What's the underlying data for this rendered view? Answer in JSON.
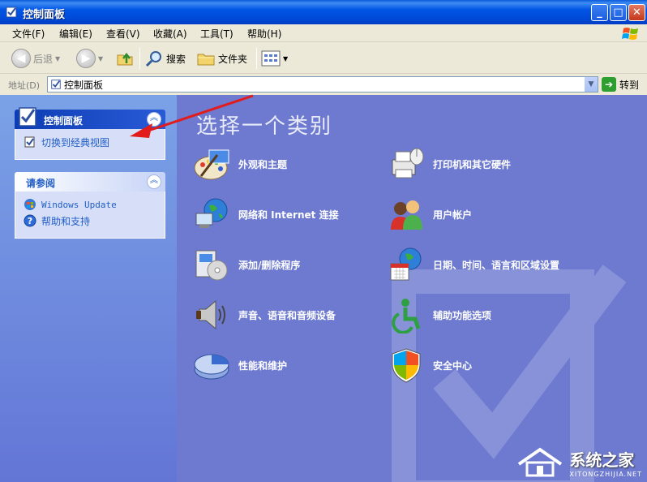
{
  "window": {
    "title": "控制面板"
  },
  "menu": [
    {
      "label": "文件(F)"
    },
    {
      "label": "编辑(E)"
    },
    {
      "label": "查看(V)"
    },
    {
      "label": "收藏(A)"
    },
    {
      "label": "工具(T)"
    },
    {
      "label": "帮助(H)"
    }
  ],
  "toolbar": {
    "back": "后退",
    "search": "搜索",
    "folders": "文件夹"
  },
  "address": {
    "label": "地址(D)",
    "value": "控制面板",
    "go": "转到"
  },
  "left": {
    "control_panel": {
      "title": "控制面板",
      "link": "切换到经典视图"
    },
    "see_also": {
      "title": "请参阅",
      "links": [
        "Windows Update",
        "帮助和支持"
      ]
    }
  },
  "main": {
    "heading": "选择一个类别",
    "categories": [
      "外观和主题",
      "打印机和其它硬件",
      "网络和 Internet 连接",
      "用户帐户",
      "添加/删除程序",
      "日期、时间、语言和区域设置",
      "声音、语音和音频设备",
      "辅助功能选项",
      "性能和维护",
      "安全中心"
    ]
  },
  "watermark": {
    "text": "系统之家",
    "sub": "XITONGZHIJIA.NET"
  }
}
